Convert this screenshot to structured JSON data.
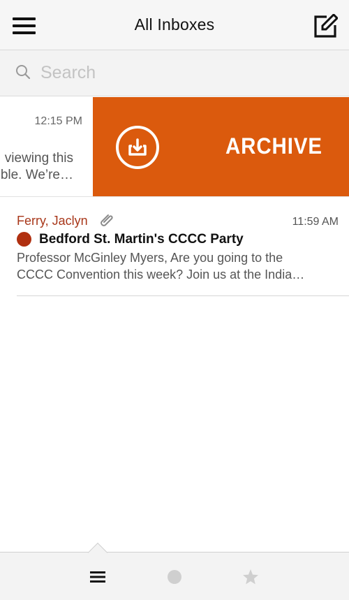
{
  "header": {
    "title": "All Inboxes",
    "menu_icon": "hamburger-menu-icon",
    "compose_icon": "compose-icon"
  },
  "search": {
    "placeholder": "Search",
    "value": "",
    "icon": "search-icon"
  },
  "swiped_row": {
    "time": "12:15 PM",
    "preview_line1": "viewing this",
    "preview_line2": "ble. We’re…",
    "action_label": "ARCHIVE",
    "action_icon": "archive-icon",
    "action_color": "#db5a0d"
  },
  "emails": [
    {
      "sender": "Ferry, Jaclyn",
      "time": "11:59 AM",
      "subject": "Bedford St. Martin's CCCC Party",
      "preview_line1": "Professor McGinley Myers, Are you going to the",
      "preview_line2": "CCCC Convention this week? Join us at the India…",
      "has_attachment": true,
      "unread": true,
      "sender_color": "#a8371a",
      "unread_color": "#b03010"
    }
  ],
  "tab_bar": {
    "tabs": [
      {
        "icon": "list-icon",
        "selected": true
      },
      {
        "icon": "unread-dot-icon",
        "selected": false
      },
      {
        "icon": "star-icon",
        "selected": false
      }
    ]
  }
}
